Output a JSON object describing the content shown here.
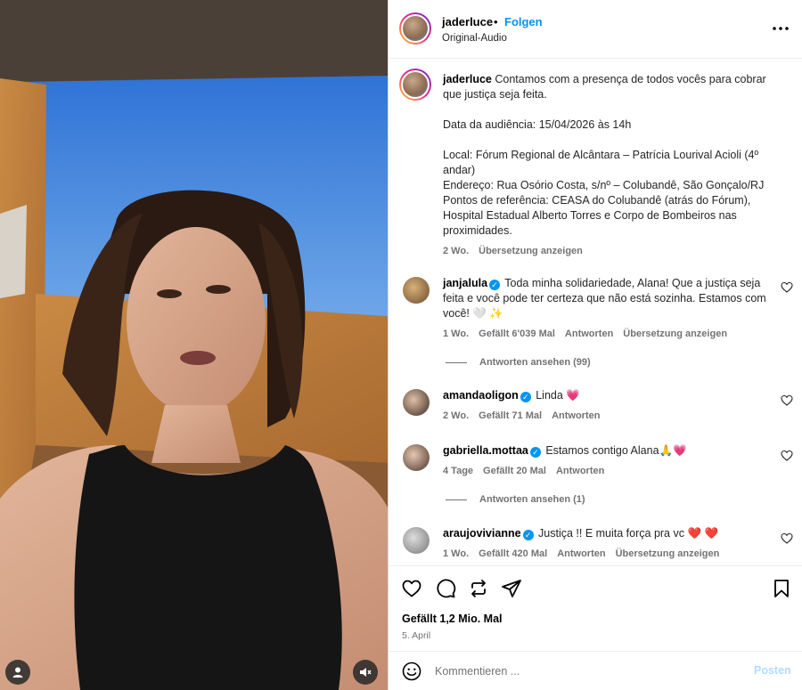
{
  "post": {
    "username": "jaderluce",
    "separator": "•",
    "follow_label": "Folgen",
    "audio_label": "Original-Audio",
    "more_icon": "more-horizontal-icon"
  },
  "caption": {
    "username": "jaderluce",
    "lines": [
      "Contamos com a presença de todos vocês para cobrar que justiça seja feita.",
      "",
      "Data da audiência: 15/04/2026 às 14h",
      "",
      "Local: Fórum Regional de Alcântara – Patrícia Lourival Acioli (4º andar)",
      "Endereço: Rua Osório Costa, s/nº – Colubandê, São Gonçalo/RJ",
      "Pontos de referência: CEASA do Colubandê (atrás do Fórum), Hospital Estadual Alberto Torres e Corpo de Bombeiros nas proximidades."
    ],
    "time": "2 Wo.",
    "translate_label": "Übersetzung anzeigen"
  },
  "comments": [
    {
      "username": "janjalula",
      "verified": true,
      "text": "Toda minha solidariedade, Alana! Que a justiça seja feita e você pode ter certeza que não está sozinha. Estamos com você! 🤍 ✨",
      "time": "1 Wo.",
      "likes": "Gefällt 6'039 Mal",
      "reply_label": "Antworten",
      "translate_label": "Übersetzung anzeigen",
      "view_replies": "Antworten ansehen (99)"
    },
    {
      "username": "amandaoligon",
      "verified": true,
      "text": "Linda 💗",
      "time": "2 Wo.",
      "likes": "Gefällt 71 Mal",
      "reply_label": "Antworten"
    },
    {
      "username": "gabriella.mottaa",
      "verified": true,
      "text": "Estamos contigo Alana🙏💗",
      "time": "4 Tage",
      "likes": "Gefällt 20 Mal",
      "reply_label": "Antworten",
      "view_replies": "Antworten ansehen (1)"
    },
    {
      "username": "araujovivianne",
      "verified": true,
      "text": "Justiça !! E muita força pra vc ❤️ ❤️",
      "time": "1 Wo.",
      "likes": "Gefällt 420 Mal",
      "reply_label": "Antworten",
      "translate_label": "Übersetzung anzeigen"
    }
  ],
  "actions": {
    "like_icon": "heart-icon",
    "comment_icon": "comment-icon",
    "repost_icon": "repost-icon",
    "share_icon": "share-icon",
    "save_icon": "bookmark-icon",
    "likes_total": "Gefällt 1,2 Mio. Mal",
    "date": "5. April"
  },
  "composer": {
    "placeholder": "Kommentieren ...",
    "post_label": "Posten",
    "emoji_icon": "emoji-icon"
  },
  "media": {
    "user_icon": "user-tag-icon",
    "mute_icon": "muted-speaker-icon"
  },
  "colors": {
    "link_blue": "#0095f6",
    "post_disabled": "#b3dbff",
    "muted_text": "#737373"
  }
}
